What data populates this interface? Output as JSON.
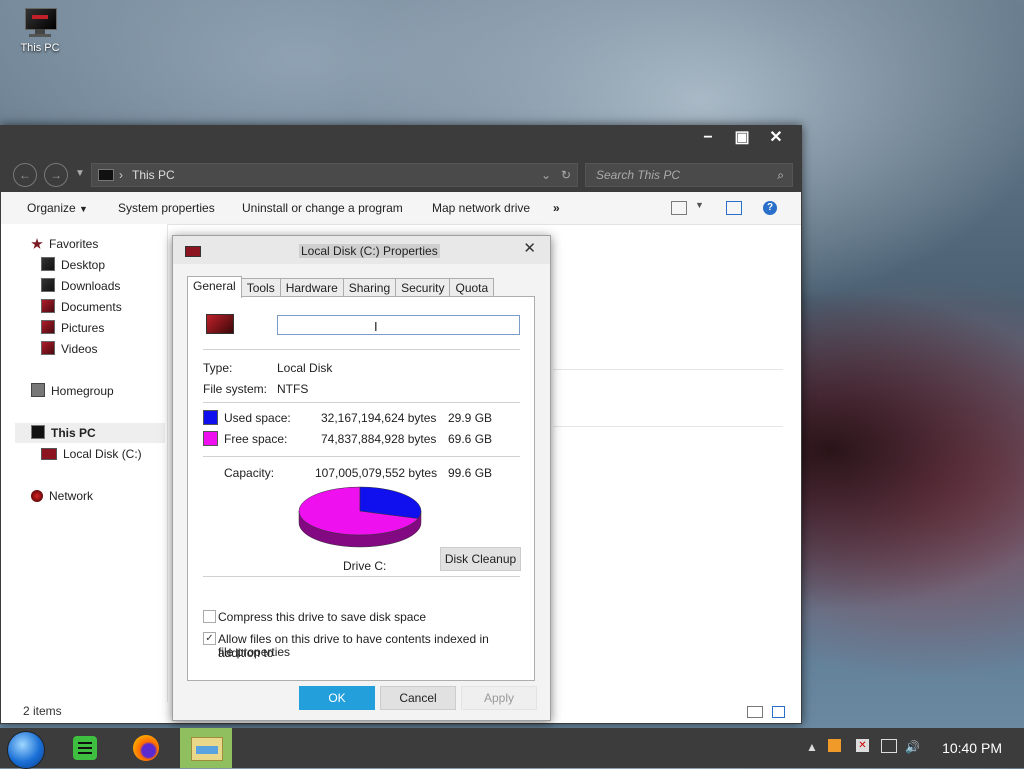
{
  "desktop": {
    "this_pc_label": "This PC"
  },
  "explorer": {
    "address_path": "This PC",
    "search_placeholder": "Search This PC",
    "toolbar": {
      "organize": "Organize",
      "system_properties": "System properties",
      "uninstall": "Uninstall or change a program",
      "map_drive": "Map network drive",
      "more": "»"
    },
    "nav": {
      "favorites": "Favorites",
      "desktop": "Desktop",
      "downloads": "Downloads",
      "documents": "Documents",
      "pictures": "Pictures",
      "videos": "Videos",
      "homegroup": "Homegroup",
      "this_pc": "This PC",
      "local_disk": "Local Disk (C:)",
      "network": "Network"
    },
    "status_items": "2 items"
  },
  "dialog": {
    "title": "Local Disk (C:) Properties",
    "tabs": [
      "General",
      "Tools",
      "Hardware",
      "Sharing",
      "Security",
      "Quota"
    ],
    "drive_name_value": "",
    "type_label": "Type:",
    "type_value": "Local Disk",
    "fs_label": "File system:",
    "fs_value": "NTFS",
    "used_label": "Used space:",
    "used_bytes": "32,167,194,624 bytes",
    "used_gb": "29.9 GB",
    "free_label": "Free space:",
    "free_bytes": "74,837,884,928 bytes",
    "free_gb": "69.6 GB",
    "capacity_label": "Capacity:",
    "capacity_bytes": "107,005,079,552 bytes",
    "capacity_gb": "99.6 GB",
    "drive_label": "Drive C:",
    "disk_cleanup": "Disk Cleanup",
    "compress_label": "Compress this drive to save disk space",
    "compress_checked": false,
    "index_label_1": "Allow files on this drive to have contents indexed in addition to",
    "index_label_2": "file properties",
    "index_checked": true,
    "ok": "OK",
    "cancel": "Cancel",
    "apply": "Apply",
    "used_color": "#1010ee",
    "free_color": "#ee10ee",
    "used_fraction": 0.3006
  },
  "taskbar": {
    "clock": "10:40 PM"
  }
}
